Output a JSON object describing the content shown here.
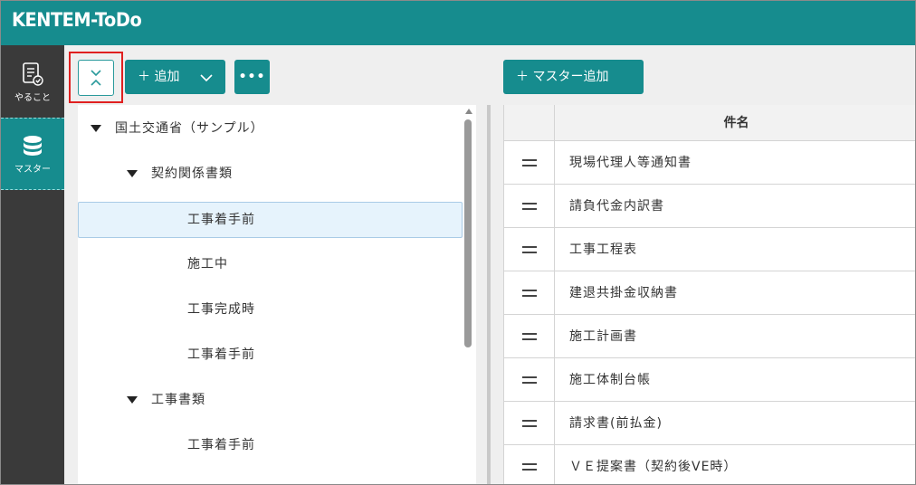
{
  "app": {
    "title": "KENTEM-ToDo"
  },
  "sidebar": {
    "items": [
      {
        "label": "やること",
        "icon": "checklist-icon"
      },
      {
        "label": "マスター",
        "icon": "database-icon"
      }
    ]
  },
  "toolbar": {
    "add_label": "＋ 追加",
    "more_label": "•••",
    "master_add_label": "＋ マスター追加"
  },
  "tree": {
    "nodes": [
      {
        "label": "国土交通省（サンプル）",
        "level": 0,
        "expanded": true
      },
      {
        "label": "契約関係書類",
        "level": 1,
        "expanded": true
      },
      {
        "label": "工事着手前",
        "level": 2,
        "selected": true
      },
      {
        "label": "施工中",
        "level": 2
      },
      {
        "label": "工事完成時",
        "level": 2
      },
      {
        "label": "工事着手前",
        "level": 2
      },
      {
        "label": "工事書類",
        "level": 1,
        "expanded": true
      },
      {
        "label": "工事着手前",
        "level": 2
      }
    ]
  },
  "table": {
    "header": "件名",
    "rows": [
      "現場代理人等通知書",
      "請負代金内訳書",
      "工事工程表",
      "建退共掛金収納書",
      "施工計画書",
      "施工体制台帳",
      "請求書(前払金)",
      "ＶＥ提案書（契約後VE時）"
    ]
  },
  "colors": {
    "accent": "#168c8e",
    "sidebar_bg": "#3a3a3a",
    "selected_row": "#e6f3fc",
    "highlight_box": "#e02020"
  }
}
